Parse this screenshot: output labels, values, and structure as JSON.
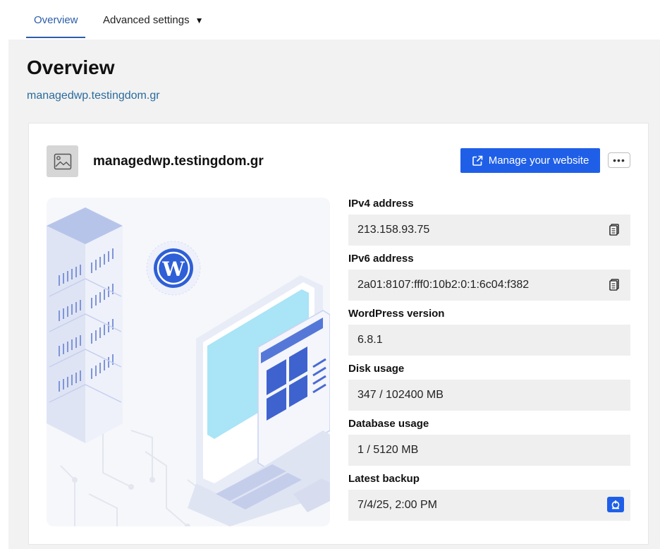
{
  "tabs": {
    "overview": "Overview",
    "advanced": "Advanced settings",
    "advanced_caret": "▼"
  },
  "page": {
    "title": "Overview",
    "domain_link": "managedwp.testingdom.gr"
  },
  "card": {
    "site_name": "managedwp.testingdom.gr",
    "manage_label": "Manage your website",
    "more_label": "•••"
  },
  "fields": {
    "ipv4": {
      "label": "IPv4 address",
      "value": "213.158.93.75"
    },
    "ipv6": {
      "label": "IPv6 address",
      "value": "2a01:8107:fff0:10b2:0:1:6c04:f382"
    },
    "wp_version": {
      "label": "WordPress version",
      "value": "6.8.1"
    },
    "disk": {
      "label": "Disk usage",
      "value": "347 / 102400 MB"
    },
    "database": {
      "label": "Database usage",
      "value": "1 / 5120 MB"
    },
    "backup": {
      "label": "Latest backup",
      "value": "7/4/25, 2:00 PM"
    }
  },
  "colors": {
    "accent": "#1f5fe8",
    "link": "#2a6b9c",
    "tab_active": "#2b5ea8",
    "panel_bg": "#f2f2f2",
    "field_bg": "#efefef"
  },
  "icons": {
    "thumb": "image-placeholder-icon",
    "manage": "external-link-icon",
    "copy": "copy-icon",
    "restore": "restore-backup-icon",
    "illustration": "wordpress-hosting-illustration"
  }
}
